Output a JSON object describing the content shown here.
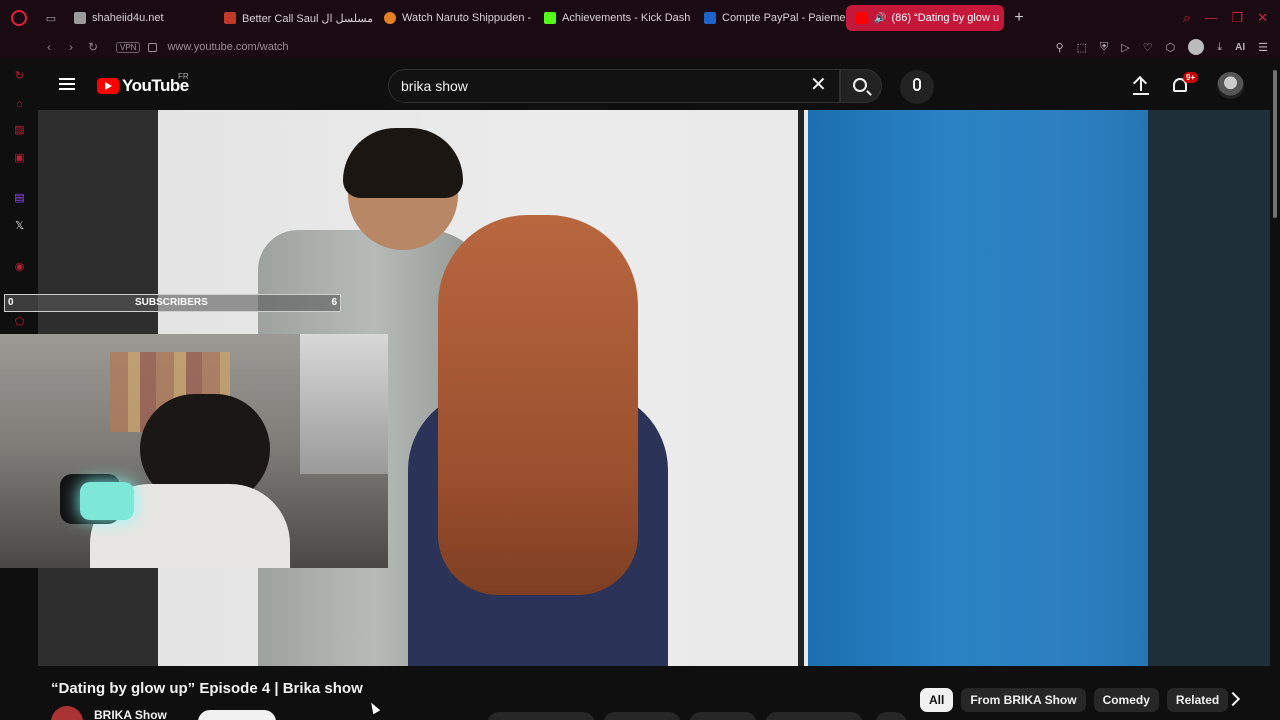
{
  "browser": {
    "tabs": [
      {
        "label": "shaheiid4u.net",
        "favicon_color": "#9c9c9c"
      },
      {
        "label": "Better Call Saul مسلسل ال",
        "favicon_color": "#c0392b"
      },
      {
        "label": "Watch Naruto Shippuden -",
        "favicon_color": "#e67e22"
      },
      {
        "label": "Achievements - Kick Dash",
        "favicon_color": "#53fc18"
      },
      {
        "label": "Compte PayPal - Paiemen",
        "favicon_color": "#1e64c8"
      },
      {
        "label": "(86) “Dating by glow u",
        "favicon_color": "#ff0000",
        "active": true
      }
    ],
    "new_tab": "+",
    "address": "www.youtube.com/watch",
    "vpn_label": "VPN",
    "ai_label": "AI",
    "accent": "#c4173a"
  },
  "youtube": {
    "logo_text": "YouTube",
    "country": "FR",
    "search_value": "brika show",
    "notification_badge": "9+"
  },
  "overlay": {
    "left": "0",
    "center": "SUBSCRIBERS",
    "right": "6"
  },
  "video": {
    "title": "“Dating by glow up” Episode 4 | Brika show",
    "channel": "BRIKA Show"
  },
  "chips": [
    "All",
    "From BRIKA Show",
    "Comedy",
    "Related"
  ]
}
